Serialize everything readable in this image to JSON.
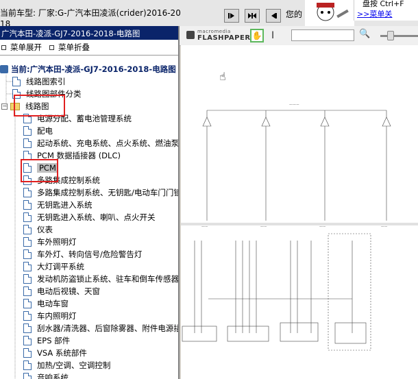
{
  "topbar": {
    "car_title": "当前车型:  厂家:G-广汽本田凌派(crider)2016-2018",
    "marquee_text": "您的",
    "hint_text": "盘按 Ctrl+F",
    "hint_link": ">>菜单关"
  },
  "tree_panel": {
    "header": "广汽本田-凌派-GJ7-2016-2018-电路图",
    "expand_all": "菜单展开",
    "collapse_all": "菜单折叠",
    "root": "当前:广汽本田-凌派-GJ7-2016-2018-电路图",
    "level1": [
      "线路图索引",
      "线路图部件分类",
      "线路图"
    ],
    "items": [
      "电源分配、蓄电池管理系统",
      "配电",
      "起动系统、充电系统、点火系统、燃油泵",
      "PCM 数据插接器 (DLC)",
      "PCM",
      "多路集成控制系统",
      "多路集成控制系统、无钥匙/电动车门门锁/",
      "无钥匙进入系统",
      "无钥匙进入系统、喇叭、点火开关",
      "仪表",
      "车外照明灯",
      "车外灯、转向信号/危险警告灯",
      "大灯调平系统",
      "发动机防盗锁止系统、驻车和倒车传感器系统",
      "电动后视镜、天窗",
      "电动车窗",
      "车内照明灯",
      "刮水器/清洗器、后窗除雾器、附件电源插座",
      "EPS 部件",
      "VSA 系统部件",
      "加热/空调、空调控制",
      "音响系统"
    ],
    "selected": "PCM"
  },
  "viewer": {
    "logo_sub": "macromedia",
    "logo": "FLASHPAPER",
    "colors": {
      "highlight": "#e02020",
      "tree_header_bg": "#0a246a",
      "hand_tool_border": "#5cb85c"
    }
  }
}
